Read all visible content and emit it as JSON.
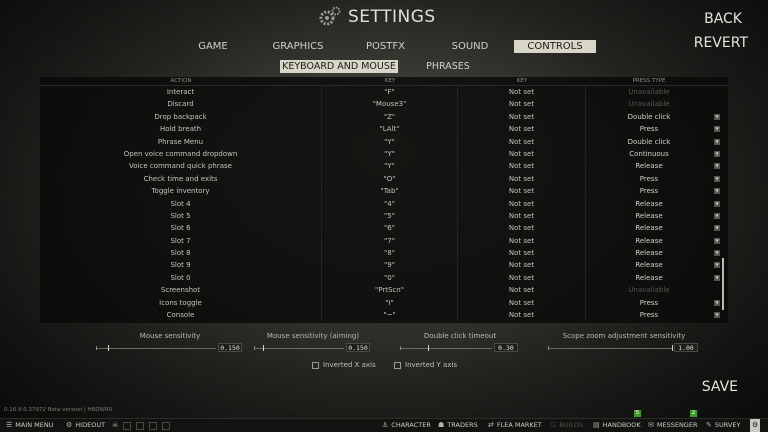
{
  "title": "SETTINGS",
  "right_links": {
    "back": "BACK",
    "revert": "REVERT"
  },
  "tabs": [
    {
      "label": "GAME"
    },
    {
      "label": "GRAPHICS"
    },
    {
      "label": "POSTFX"
    },
    {
      "label": "SOUND"
    },
    {
      "label": "CONTROLS"
    }
  ],
  "subtabs": [
    {
      "label": "KEYBOARD AND MOUSE"
    },
    {
      "label": "PHRASES"
    }
  ],
  "columns": {
    "action": "ACTION",
    "key1": "KEY",
    "key2": "KEY",
    "press": "PRESS TYPE"
  },
  "rows": [
    {
      "action": "Interact",
      "key": "\"F\"",
      "alt": "Not set",
      "press": "Unavailable"
    },
    {
      "action": "Discard",
      "key": "\"Mouse3\"",
      "alt": "Not set",
      "press": "Unavailable"
    },
    {
      "action": "Drop backpack",
      "key": "\"Z\"",
      "alt": "Not set",
      "press": "Double click"
    },
    {
      "action": "Hold breath",
      "key": "\"LAlt\"",
      "alt": "Not set",
      "press": "Press"
    },
    {
      "action": "Phrase Menu",
      "key": "\"Y\"",
      "alt": "Not set",
      "press": "Double click"
    },
    {
      "action": "Open voice command dropdown",
      "key": "\"Y\"",
      "alt": "Not set",
      "press": "Continuous"
    },
    {
      "action": "Voice command quick phrase",
      "key": "\"Y\"",
      "alt": "Not set",
      "press": "Release"
    },
    {
      "action": "Check time and exits",
      "key": "\"O\"",
      "alt": "Not set",
      "press": "Press"
    },
    {
      "action": "Toggle inventory",
      "key": "\"Tab\"",
      "alt": "Not set",
      "press": "Press"
    },
    {
      "action": "Slot 4",
      "key": "\"4\"",
      "alt": "Not set",
      "press": "Release"
    },
    {
      "action": "Slot 5",
      "key": "\"5\"",
      "alt": "Not set",
      "press": "Release"
    },
    {
      "action": "Slot 6",
      "key": "\"6\"",
      "alt": "Not set",
      "press": "Release"
    },
    {
      "action": "Slot 7",
      "key": "\"7\"",
      "alt": "Not set",
      "press": "Release"
    },
    {
      "action": "Slot 8",
      "key": "\"8\"",
      "alt": "Not set",
      "press": "Release"
    },
    {
      "action": "Slot 9",
      "key": "\"9\"",
      "alt": "Not set",
      "press": "Release"
    },
    {
      "action": "Slot 0",
      "key": "\"0\"",
      "alt": "Not set",
      "press": "Release"
    },
    {
      "action": "Screenshot",
      "key": "\"PrtScn\"",
      "alt": "Not set",
      "press": "Unavailable"
    },
    {
      "action": "Icons toggle",
      "key": "\"I\"",
      "alt": "Not set",
      "press": "Press"
    },
    {
      "action": "Console",
      "key": "\"~\"",
      "alt": "Not set",
      "press": "Press"
    }
  ],
  "sliders": [
    {
      "label": "Mouse sensitivity",
      "value": "0.150",
      "level": 0.1
    },
    {
      "label": "Mouse sensitivity (aiming)",
      "value": "0.150",
      "level": 0.1
    },
    {
      "label": "Double click timeout",
      "value": "0.30",
      "level": 0.3
    },
    {
      "label": "Scope zoom adjustment sensitivity",
      "value": "1.00",
      "level": 1.0
    }
  ],
  "checkboxes": [
    {
      "label": "Inverted X axis"
    },
    {
      "label": "Inverted Y axis"
    }
  ],
  "save": "SAVE",
  "version": "0.16.9.0.37972 Beta version | H8DWR0",
  "bottom": {
    "main_menu": "MAIN MENU",
    "hideout": "HIDEOUT",
    "character": "CHARACTER",
    "traders": "TRADERS",
    "flea": "FLEA MARKET",
    "builds": "BUILDS",
    "handbook": "HANDBOOK",
    "messenger": "MESSENGER",
    "survey": "SURVEY",
    "handbook_badge": "5",
    "messenger_badge": "2"
  },
  "colors": {
    "active_tab": "#d8d6c8",
    "badge": "#3f9a2a"
  }
}
